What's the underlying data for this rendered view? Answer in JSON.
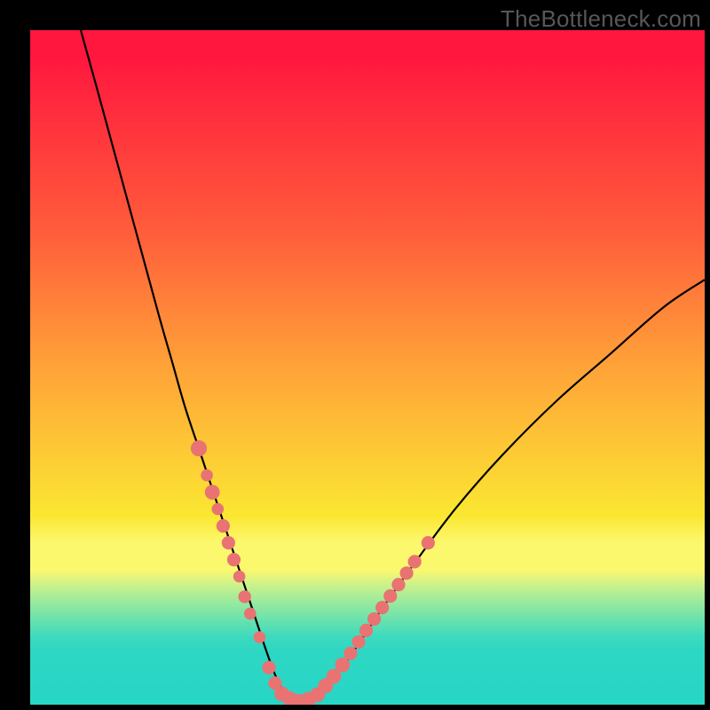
{
  "watermark": "TheBottleneck.com",
  "colors": {
    "frame": "#000000",
    "curve": "#000000",
    "marker": "#e97373",
    "gradient_stops": [
      "#ff173e",
      "#ff5d3b",
      "#ffa338",
      "#fbe732",
      "#fcf86e",
      "#d0f289",
      "#95e99f",
      "#5fe0b1",
      "#3cdabe",
      "#2ed7c3",
      "#27d6c6"
    ]
  },
  "chart_data": {
    "type": "line",
    "title": "",
    "xlabel": "",
    "ylabel": "",
    "xlim": [
      0,
      100
    ],
    "ylim": [
      0,
      100
    ],
    "series": [
      {
        "name": "curve",
        "x": [
          7.5,
          10,
          13,
          16,
          19,
          21,
          23,
          25,
          27,
          29,
          31,
          33,
          35,
          36.5,
          38,
          40,
          42,
          45,
          48,
          52,
          57,
          63,
          70,
          78,
          86,
          94,
          100
        ],
        "y": [
          100,
          91,
          80,
          69,
          58,
          51,
          44,
          38,
          32,
          26,
          20,
          14,
          8,
          4,
          1.5,
          0.5,
          1.2,
          4,
          8,
          14,
          21,
          29,
          37,
          45,
          52,
          59,
          63
        ]
      }
    ],
    "markers": [
      {
        "x": 25,
        "y": 38,
        "r": 1.2
      },
      {
        "x": 26.2,
        "y": 34,
        "r": 0.9
      },
      {
        "x": 27,
        "y": 31.5,
        "r": 1.1
      },
      {
        "x": 27.8,
        "y": 29,
        "r": 0.9
      },
      {
        "x": 28.6,
        "y": 26.5,
        "r": 1.0
      },
      {
        "x": 29.4,
        "y": 24,
        "r": 1.0
      },
      {
        "x": 30.2,
        "y": 21.5,
        "r": 1.0
      },
      {
        "x": 31.0,
        "y": 19,
        "r": 0.9
      },
      {
        "x": 31.8,
        "y": 16,
        "r": 0.95
      },
      {
        "x": 32.6,
        "y": 13.5,
        "r": 0.9
      },
      {
        "x": 34,
        "y": 10,
        "r": 0.9
      },
      {
        "x": 35.4,
        "y": 5.5,
        "r": 1.0
      },
      {
        "x": 36.3,
        "y": 3.2,
        "r": 1.0
      },
      {
        "x": 37.3,
        "y": 1.6,
        "r": 1.1
      },
      {
        "x": 38.5,
        "y": 0.9,
        "r": 1.1
      },
      {
        "x": 40.0,
        "y": 0.5,
        "r": 1.1
      },
      {
        "x": 41.3,
        "y": 0.8,
        "r": 1.1
      },
      {
        "x": 42.6,
        "y": 1.5,
        "r": 1.1
      },
      {
        "x": 43.8,
        "y": 2.8,
        "r": 1.1
      },
      {
        "x": 45.0,
        "y": 4.2,
        "r": 1.1
      },
      {
        "x": 46.3,
        "y": 5.9,
        "r": 1.1
      },
      {
        "x": 47.5,
        "y": 7.6,
        "r": 1.0
      },
      {
        "x": 48.7,
        "y": 9.3,
        "r": 1.0
      },
      {
        "x": 49.8,
        "y": 11,
        "r": 1.0
      },
      {
        "x": 51.0,
        "y": 12.7,
        "r": 1.0
      },
      {
        "x": 52.2,
        "y": 14.4,
        "r": 1.0
      },
      {
        "x": 53.4,
        "y": 16.1,
        "r": 1.0
      },
      {
        "x": 54.6,
        "y": 17.8,
        "r": 1.0
      },
      {
        "x": 55.8,
        "y": 19.5,
        "r": 1.0
      },
      {
        "x": 57.0,
        "y": 21.2,
        "r": 1.0
      },
      {
        "x": 59.0,
        "y": 24.0,
        "r": 1.0
      }
    ]
  }
}
